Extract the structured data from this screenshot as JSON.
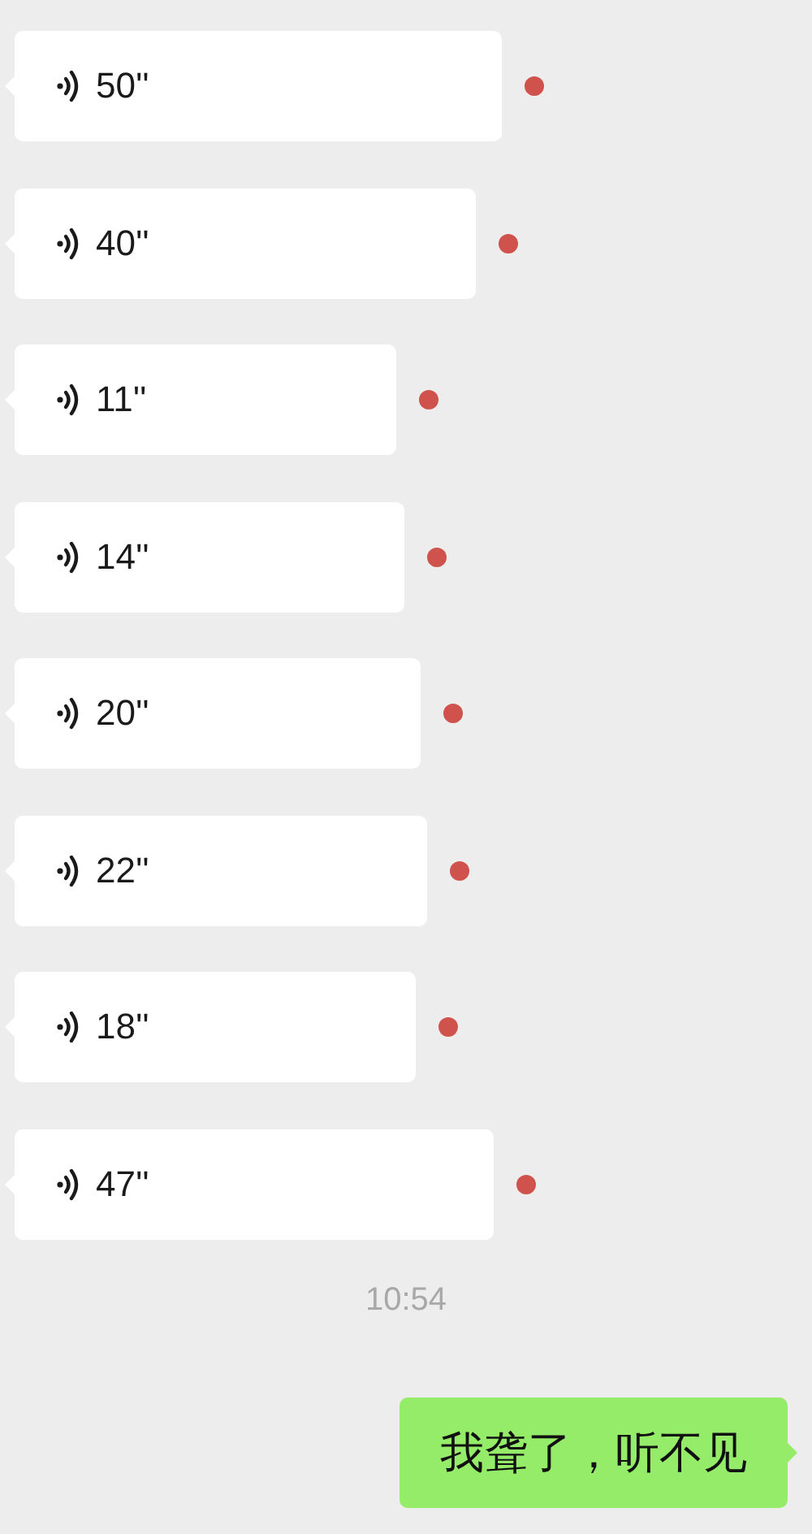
{
  "messages": [
    {
      "kind": "voice",
      "duration": "50''",
      "unread": true
    },
    {
      "kind": "voice",
      "duration": "40''",
      "unread": true
    },
    {
      "kind": "voice",
      "duration": "11''",
      "unread": true
    },
    {
      "kind": "voice",
      "duration": "14''",
      "unread": true
    },
    {
      "kind": "voice",
      "duration": "20''",
      "unread": true
    },
    {
      "kind": "voice",
      "duration": "22''",
      "unread": true
    },
    {
      "kind": "voice",
      "duration": "18''",
      "unread": true
    },
    {
      "kind": "voice",
      "duration": "47''",
      "unread": true
    },
    {
      "kind": "time",
      "text": "10:54"
    },
    {
      "kind": "text",
      "text": "我聋了，听不见"
    }
  ]
}
